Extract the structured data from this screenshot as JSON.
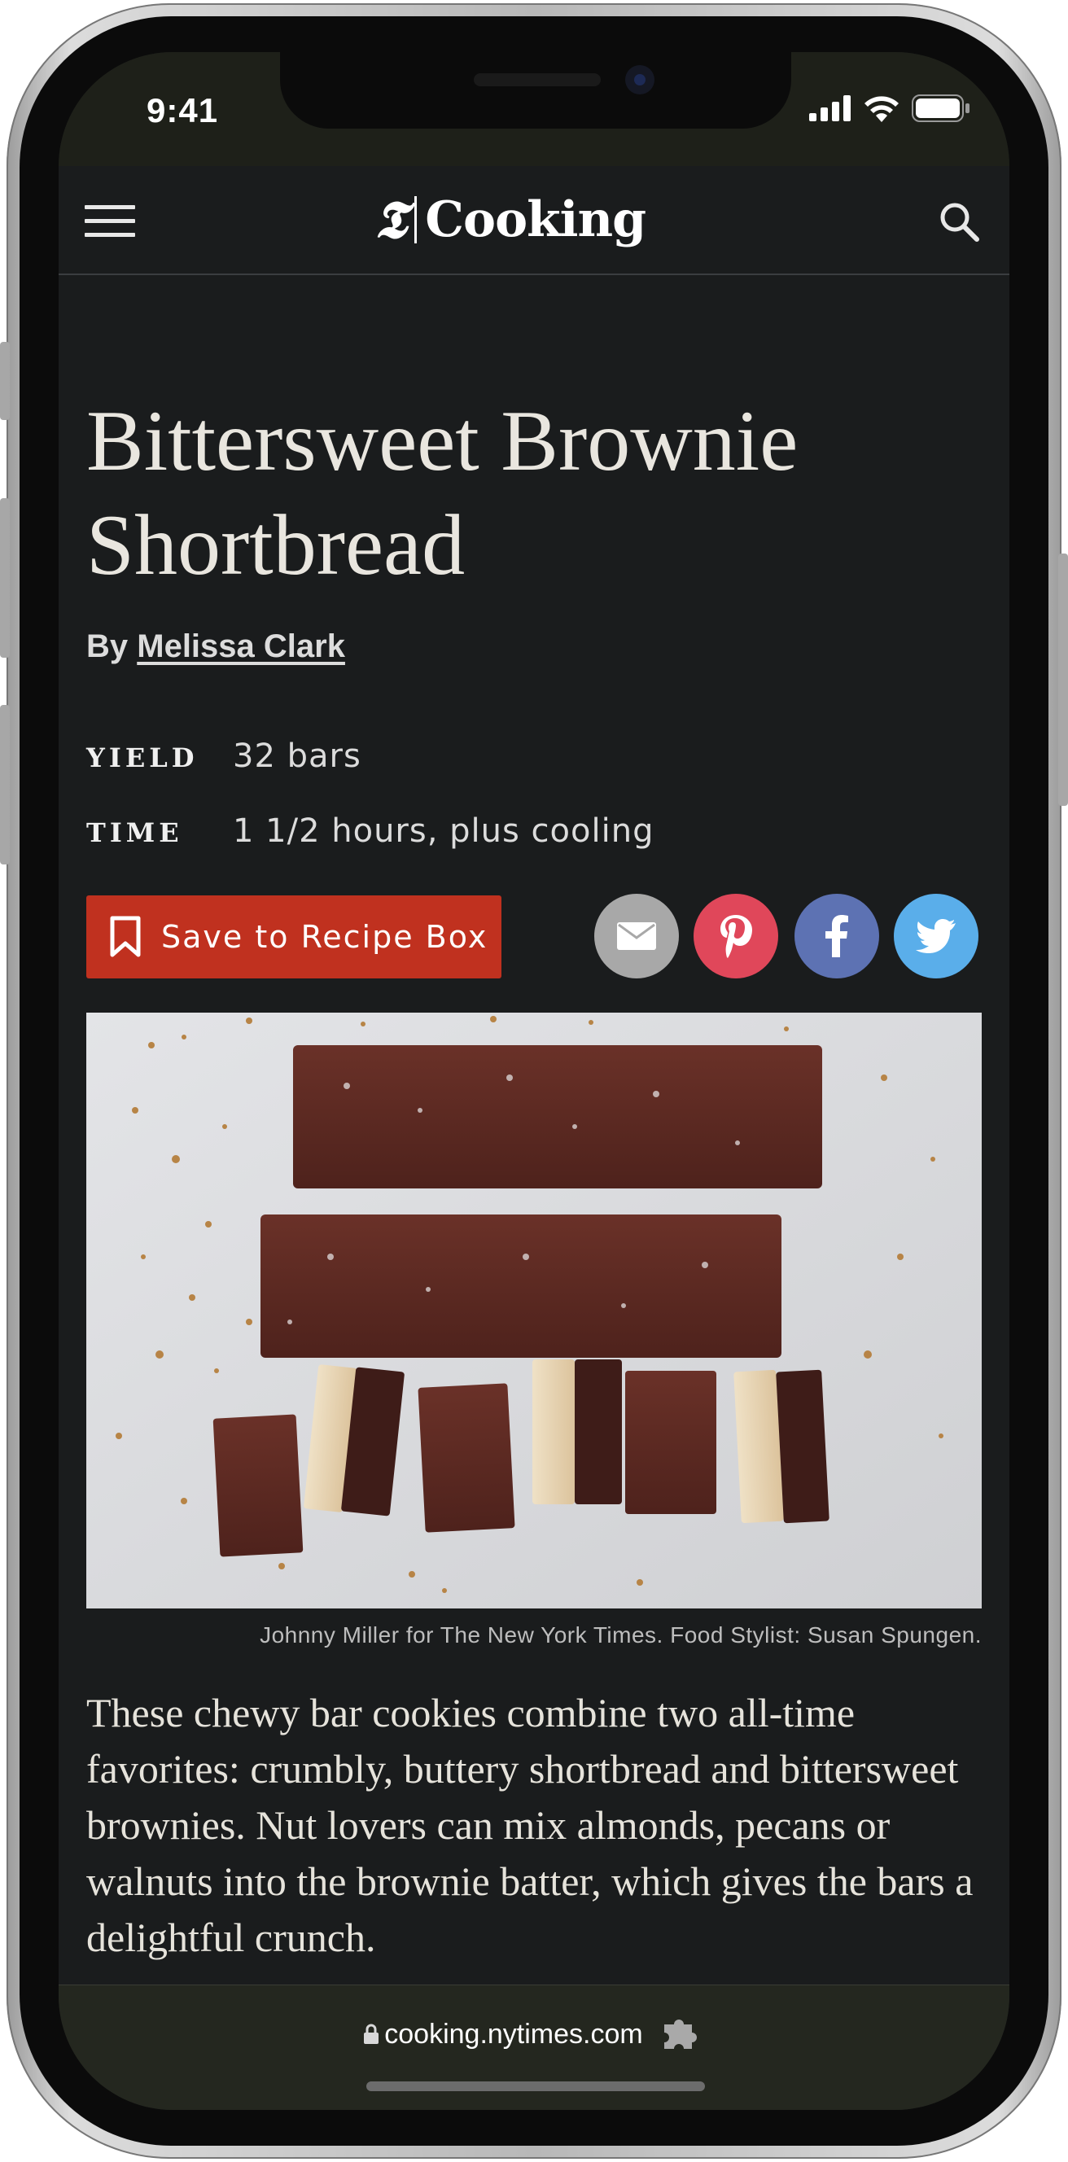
{
  "status_bar": {
    "time": "9:41"
  },
  "header": {
    "logo_mark": "𝕿",
    "logo_text": "Cooking",
    "menu_icon": "hamburger-icon",
    "search_icon": "search-icon"
  },
  "recipe": {
    "title": "Bittersweet Brownie Shortbread",
    "by_prefix": "By ",
    "author": "Melissa Clark",
    "yield_label": "YIELD",
    "yield_value": "32 bars",
    "time_label": "TIME",
    "time_value": "1 1/2 hours, plus cooling",
    "save_label": "Save to Recipe Box",
    "photo_caption": "Johnny Miller for The New York Times. Food Stylist: Susan Spungen.",
    "description": "These chewy bar cookies combine two all-time favorites: crumbly, buttery shortbread and bittersweet brownies. Nut lovers can mix almonds, pecans or walnuts into the brownie batter, which gives the bars a delightful crunch."
  },
  "share_buttons": [
    {
      "name": "email",
      "icon": "envelope-icon",
      "color": "#a8a8a8"
    },
    {
      "name": "pinterest",
      "icon": "pinterest-icon",
      "color": "#e0475a"
    },
    {
      "name": "facebook",
      "icon": "facebook-icon",
      "color": "#5d72b3"
    },
    {
      "name": "twitter",
      "icon": "twitter-icon",
      "color": "#5aaeea"
    }
  ],
  "browser": {
    "url": "cooking.nytimes.com"
  },
  "colors": {
    "background": "#1a1c1d",
    "save_button": "#c0311f",
    "title_text": "#e9e6df"
  }
}
